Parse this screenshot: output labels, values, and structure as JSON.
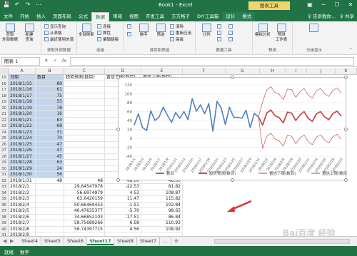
{
  "title_bar": {
    "title": "Book1 - Excel",
    "context_tab": "图表工具",
    "qat": [
      "💾",
      "↶",
      "↷",
      "⋯"
    ],
    "window_buttons": [
      "▣",
      "─",
      "☐",
      "✕"
    ]
  },
  "ribbon_tabs": [
    "文件",
    "开始",
    "插入",
    "页面布局",
    "公式",
    "数据",
    "审阅",
    "视图",
    "开发工具",
    "方方格子",
    "DIY工具箱",
    "设计",
    "格式"
  ],
  "ribbon_active_tab": "数据",
  "ribbon_right": [
    "♀ 告诉我你...",
    "♀ 共享"
  ],
  "ribbon": {
    "groups": [
      {
        "label": "获取外部数据",
        "buttons": [
          "获取\n外部数据",
          "新建\n查询"
        ]
      },
      {
        "label": "获取和转换",
        "buttons": [
          "显示查询",
          "从表格",
          "最近使用的源"
        ]
      },
      {
        "label": "连接",
        "buttons": [
          "全部刷新",
          "连接",
          "属性",
          "编辑链接"
        ]
      },
      {
        "label": "排序和筛选",
        "buttons": [
          "排序",
          "筛选",
          "清除",
          "重新应用",
          "高级"
        ]
      },
      {
        "label": "数据工具",
        "buttons": [
          "分列"
        ]
      },
      {
        "label": "预测",
        "buttons": [
          "模拟分析",
          "预测\n工作表"
        ]
      },
      {
        "label": "分级显示",
        "buttons": [
          "分级显示"
        ]
      }
    ]
  },
  "formula_bar": {
    "name_box": "图表 1",
    "cancel": "✕",
    "enter": "✓",
    "fx": "fx",
    "value": ""
  },
  "columns": [
    "A",
    "B",
    "C",
    "D",
    "E",
    "F",
    "G",
    "H",
    "I",
    "J",
    "K"
  ],
  "header_row": {
    "row": "15",
    "A": "日期",
    "B": "数目",
    "C": "趋势预测(数目)",
    "D": "置信下限(数目)",
    "E": "置信上限(数目)"
  },
  "table_rows": [
    {
      "row": "16",
      "date": "2018/1/15",
      "count": "89",
      "trend": "",
      "lower": "",
      "upper": ""
    },
    {
      "row": "17",
      "date": "2018/1/16",
      "count": "61",
      "trend": "",
      "lower": "",
      "upper": ""
    },
    {
      "row": "18",
      "date": "2018/1/17",
      "count": "75",
      "trend": "",
      "lower": "",
      "upper": ""
    },
    {
      "row": "19",
      "date": "2018/1/18",
      "count": "55",
      "trend": "",
      "lower": "",
      "upper": ""
    },
    {
      "row": "20",
      "date": "2018/1/19",
      "count": "78",
      "trend": "",
      "lower": "",
      "upper": ""
    },
    {
      "row": "21",
      "date": "2018/1/20",
      "count": "16",
      "trend": "",
      "lower": "",
      "upper": ""
    },
    {
      "row": "22",
      "date": "2018/1/21",
      "count": "83",
      "trend": "",
      "lower": "",
      "upper": ""
    },
    {
      "row": "23",
      "date": "2018/1/22",
      "count": "68",
      "trend": "",
      "lower": "",
      "upper": ""
    },
    {
      "row": "24",
      "date": "2018/1/23",
      "count": "31",
      "trend": "",
      "lower": "",
      "upper": ""
    },
    {
      "row": "25",
      "date": "2018/1/24",
      "count": "70",
      "trend": "",
      "lower": "",
      "upper": ""
    },
    {
      "row": "26",
      "date": "2018/1/25",
      "count": "47",
      "trend": "",
      "lower": "",
      "upper": ""
    },
    {
      "row": "27",
      "date": "2018/1/26",
      "count": "47",
      "trend": "",
      "lower": "",
      "upper": ""
    },
    {
      "row": "28",
      "date": "2018/1/27",
      "count": "45",
      "trend": "",
      "lower": "",
      "upper": ""
    },
    {
      "row": "29",
      "date": "2018/1/28",
      "count": "63",
      "trend": "",
      "lower": "",
      "upper": ""
    },
    {
      "row": "30",
      "date": "2018/1/29",
      "count": "24",
      "trend": "",
      "lower": "",
      "upper": ""
    },
    {
      "row": "31",
      "date": "2018/1/30",
      "count": "56",
      "trend": "",
      "lower": "",
      "upper": ""
    },
    {
      "row": "32",
      "date": "2018/1/31",
      "count": "48",
      "trend": "48",
      "lower": "48.00",
      "upper": "48.00"
    },
    {
      "row": "33",
      "date": "2018/2/1",
      "count": "",
      "trend": "29.64547978",
      "lower": "-22.53",
      "upper": "81.82"
    },
    {
      "row": "34",
      "date": "2018/2/2",
      "count": "",
      "trend": "56.6974979",
      "lower": "4.53",
      "upper": "108.87"
    },
    {
      "row": "35",
      "date": "2018/2/3",
      "count": "",
      "trend": "63.6420159",
      "lower": "11.47",
      "upper": "115.82"
    },
    {
      "row": "36",
      "date": "2018/2/4",
      "count": "",
      "trend": "50.66469453",
      "lower": "-1.51",
      "upper": "102.84"
    },
    {
      "row": "37",
      "date": "2018/2/5",
      "count": "",
      "trend": "46.47635377",
      "lower": "-5.70",
      "upper": "98.65"
    },
    {
      "row": "38",
      "date": "2018/2/6",
      "count": "",
      "trend": "34.66852103",
      "lower": "-17.51",
      "upper": "86.84"
    },
    {
      "row": "39",
      "date": "2018/2/7",
      "count": "",
      "trend": "58.75689266",
      "lower": "6.58",
      "upper": "110.93"
    },
    {
      "row": "40",
      "date": "2018/2/8",
      "count": "",
      "trend": "56.74397715",
      "lower": "4.56",
      "upper": "108.92"
    },
    {
      "row": "41",
      "date": "2018/2/9",
      "count": "",
      "trend": "",
      "lower": "",
      "upper": ""
    }
  ],
  "chart_data": {
    "type": "line",
    "y_ticks": [
      "120",
      "100",
      "80",
      "60",
      "40",
      "20",
      "0",
      "-20",
      "-40"
    ],
    "ylim": [
      -40,
      120
    ],
    "x": [
      "2018/1/1",
      "2018/1/2",
      "2018/1/3",
      "2018/1/4",
      "2018/1/5",
      "2018/1/6",
      "2018/1/7",
      "2018/1/8",
      "2018/1/9",
      "2018/1/10",
      "2018/1/11",
      "2018/1/12",
      "2018/1/13",
      "2018/1/14",
      "2018/1/15",
      "2018/1/16",
      "2018/1/17",
      "2018/1/18",
      "2018/1/19",
      "2018/1/20",
      "2018/1/21",
      "2018/1/22",
      "2018/1/23",
      "2018/1/24",
      "2018/1/25",
      "2018/1/26",
      "2018/1/27",
      "2018/1/28",
      "2018/1/29",
      "2018/1/30",
      "2018/1/31",
      "2018/2/1",
      "2018/2/2",
      "2018/2/3",
      "2018/2/4",
      "2018/2/5",
      "2018/2/6",
      "2018/2/7",
      "2018/2/8",
      "2018/2/9",
      "2018/2/10",
      "2018/2/11",
      "2018/2/12",
      "2018/2/13",
      "2018/2/14",
      "2018/2/15",
      "2018/2/16",
      "2018/2/17",
      "2018/2/18",
      "2018/2/19",
      "2018/2/20"
    ],
    "x_tick_labels": [
      "2018/1/1",
      "2018/1/3",
      "2018/1/5",
      "2018/1/7",
      "2018/1/9",
      "2018/1/11",
      "2018/1/13",
      "2018/1/15",
      "2018/1/17",
      "2018/1/19",
      "2018/1/21",
      "2018/1/23",
      "2018/1/25",
      "2018/1/27",
      "2018/1/29",
      "2018/1/31",
      "2018/2/2",
      "2018/2/4",
      "2018/2/6",
      "2018/2/8",
      "2018/2/10",
      "2018/2/12",
      "2018/2/14",
      "2018/2/16",
      "2018/2/18",
      "2018/2/20"
    ],
    "series": [
      {
        "name": "数目",
        "color": "#4f81bd",
        "width": 1.6,
        "values": [
          30,
          55,
          24,
          18,
          62,
          40,
          48,
          70,
          52,
          36,
          58,
          45,
          60,
          42,
          89,
          61,
          75,
          55,
          78,
          16,
          83,
          68,
          31,
          70,
          47,
          47,
          45,
          63,
          24,
          56,
          48,
          null,
          null,
          null,
          null,
          null,
          null,
          null,
          null,
          null,
          null,
          null,
          null,
          null,
          null,
          null,
          null,
          null,
          null,
          null,
          null
        ]
      },
      {
        "name": "趋势预测(数目)",
        "color": "#c0504d",
        "width": 1.8,
        "values": [
          null,
          null,
          null,
          null,
          null,
          null,
          null,
          null,
          null,
          null,
          null,
          null,
          null,
          null,
          null,
          null,
          null,
          null,
          null,
          null,
          null,
          null,
          null,
          null,
          null,
          null,
          null,
          null,
          null,
          null,
          48,
          29.6,
          56.7,
          63.6,
          50.7,
          46.5,
          34.7,
          58.8,
          56.7,
          40,
          52,
          60,
          45,
          38,
          55,
          60,
          48,
          42,
          56,
          61,
          50
        ]
      },
      {
        "name": "置信下限(数目)",
        "color": "#c0504d",
        "width": 0.7,
        "values": [
          null,
          null,
          null,
          null,
          null,
          null,
          null,
          null,
          null,
          null,
          null,
          null,
          null,
          null,
          null,
          null,
          null,
          null,
          null,
          null,
          null,
          null,
          null,
          null,
          null,
          null,
          null,
          null,
          null,
          null,
          48,
          -22.5,
          4.5,
          11.5,
          -1.5,
          -5.7,
          -17.5,
          6.6,
          4.6,
          -12,
          0,
          8,
          -7,
          -14,
          3,
          8,
          -4,
          -10,
          4,
          9,
          -2
        ]
      },
      {
        "name": "置信上限(数目)",
        "color": "#c0504d",
        "width": 0.7,
        "values": [
          null,
          null,
          null,
          null,
          null,
          null,
          null,
          null,
          null,
          null,
          null,
          null,
          null,
          null,
          null,
          null,
          null,
          null,
          null,
          null,
          null,
          null,
          null,
          null,
          null,
          null,
          null,
          null,
          null,
          null,
          48,
          81.8,
          108.9,
          115.8,
          102.8,
          98.7,
          86.8,
          110.9,
          108.9,
          92,
          104,
          112,
          97,
          90,
          107,
          112,
          100,
          94,
          108,
          113,
          102
        ]
      }
    ]
  },
  "sheet_tabs": [
    "Sheet4",
    "Sheet5",
    "Sheet6",
    "Sheet17",
    "Sheet8",
    "Sheet7",
    "..."
  ],
  "active_sheet": "Sheet17",
  "sheet_nav": [
    "◀",
    "▶",
    "⊕"
  ],
  "status_bar": {
    "left": "就绪",
    "mode": "数字"
  },
  "watermark": "Bai百度 经验",
  "colors": {
    "excel_green": "#217346",
    "selection": "#c5d6ea",
    "context_yellow": "#f3d469"
  }
}
